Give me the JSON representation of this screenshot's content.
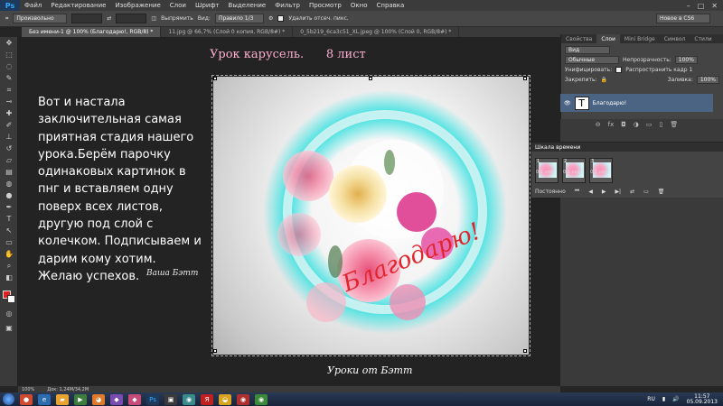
{
  "app": {
    "logo": "Ps"
  },
  "menu": [
    "Файл",
    "Редактирование",
    "Изображение",
    "Слои",
    "Шрифт",
    "Выделение",
    "Фильтр",
    "Просмотр",
    "Окно",
    "Справка"
  ],
  "window_controls": [
    "–",
    "□",
    "✕"
  ],
  "options": {
    "style": "Произвольно",
    "refine_button": "Выпрямить",
    "view_label": "Вид:",
    "view_value": "Правило 1/3",
    "delete_cropped": "Удалить отсеч. пикс.",
    "workspace": "Новое в CS6"
  },
  "tabs": [
    "Без имени-1 @ 100% (Благодарю!, RGB/8) *",
    "11.jpg @ 66,7% (Слой 0 копия, RGB/8#) *",
    "0_5b219_6ca3c51_XL.jpeg @ 100% (Слой 0, RGB/8#) *"
  ],
  "canvas": {
    "title": "Урок карусель.      8 лист",
    "text": "Вот и настала заключительная самая приятная стадия нашего урока.Берём парочку одинаковых картинок в пнг и вставляем одну поверх всех листов, другую под слой с колечком. Подписываем и дарим кому хотим.\nЖелаю успехов.",
    "signature": "Ваша Бэтт",
    "image_caption": "Благодарю!",
    "footer_sign": "Уроки от Бэтт"
  },
  "panels": {
    "tabs": [
      "Свойства",
      "Слои",
      "Mini Bridge",
      "Символ",
      "Стили"
    ],
    "active_tab": "Слои",
    "kind": "Вид",
    "blend_mode": "Обычные",
    "opacity_label": "Непрозрачность:",
    "opacity_value": "100%",
    "unify_label": "Унифицировать:",
    "propagate_label": "Распространить кадр 1",
    "lock_label": "Закрепить:",
    "fill_label": "Заливка:",
    "fill_value": "100%",
    "layer_name": "Благодарю!",
    "footer_icons": [
      "⊖",
      "fx",
      "◘",
      "◑",
      "▭",
      "▯",
      "🗑"
    ]
  },
  "timeline": {
    "title": "Шкала времени",
    "frames": [
      {
        "num": "1",
        "delay": "0,1 сек."
      },
      {
        "num": "2",
        "delay": "0,1 сек."
      },
      {
        "num": "3",
        "delay": "0,1 сек."
      }
    ],
    "loop": "Постоянно",
    "controls": [
      "⏮",
      "◀",
      "▶",
      "▶|",
      "⇄",
      "▭",
      "🗑"
    ]
  },
  "statusbar": {
    "zoom": "100%",
    "doc": "Док: 1,24M/34,2M"
  },
  "taskbar": {
    "lang": "RU",
    "time": "11:57",
    "date": "05.09.2013"
  },
  "colors": {
    "accent": "#31a8ff",
    "foreground": "#e02020",
    "layer_selected": "#4b6483"
  }
}
